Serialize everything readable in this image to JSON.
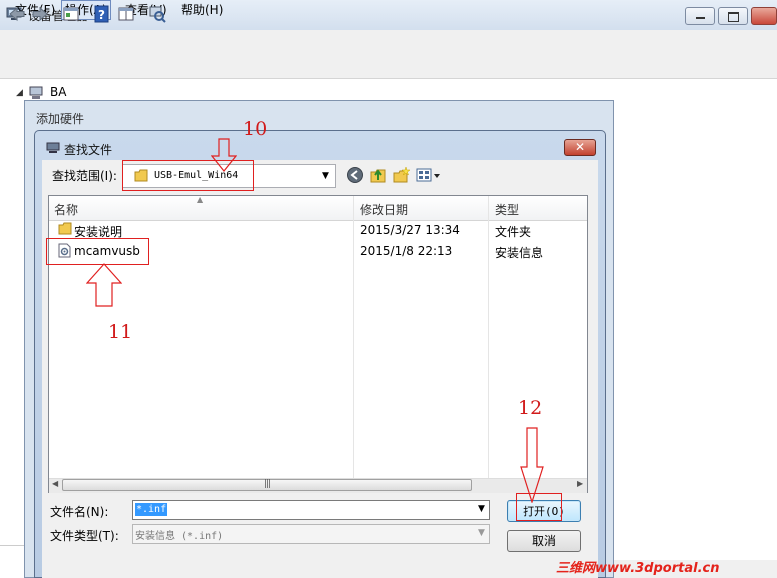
{
  "window": {
    "title": "设备管理器",
    "menu": [
      "文件(F)",
      "操作(A)",
      "查看(V)",
      "帮助(H)"
    ],
    "tree_root": "BA"
  },
  "wizard": {
    "title": "添加硬件"
  },
  "dialog": {
    "title": "查找文件",
    "close_symbol": "✕",
    "look_in_label": "查找范围(I):",
    "look_in_value": "USB-Emul_Win64",
    "columns": [
      "名称",
      "修改日期",
      "类型"
    ],
    "files": [
      {
        "name": "安装说明",
        "date": "2015/3/27 13:34",
        "type": "文件夹",
        "icon": "folder-icon"
      },
      {
        "name": "mcamvusb",
        "date": "2015/1/8 22:13",
        "type": "安装信息",
        "icon": "setup-info-file-icon"
      }
    ],
    "file_name_label": "文件名(N):",
    "file_name_value": "*.inf",
    "file_type_label": "文件类型(T):",
    "file_type_value": "安装信息 (*.inf)",
    "open_button": "打开(O)",
    "cancel_button": "取消"
  },
  "annotations": {
    "step_10": "10",
    "step_11": "11",
    "step_12": "12"
  },
  "watermark": "三维网www.3dportal.cn",
  "colors": {
    "annotation_red": "#d11a1a",
    "selection_blue": "#3399ff",
    "title_gradient": "#d3dfee"
  }
}
